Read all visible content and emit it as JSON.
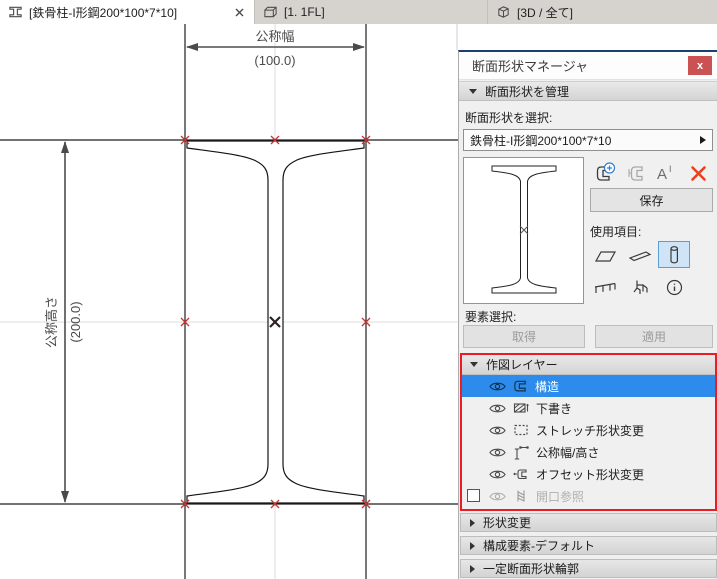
{
  "tabs": [
    {
      "icon": "i-beam-profile-icon",
      "label": "[鉄骨柱-I形鋼200*100*7*10]",
      "active": true
    },
    {
      "icon": "floor-plan-icon",
      "label": "[1. 1FL]",
      "active": false
    },
    {
      "icon": "3d-view-icon",
      "label": "[3D / 全て]",
      "active": false
    }
  ],
  "canvas": {
    "width_dim": {
      "label": "公称幅",
      "value": "(100.0)"
    },
    "height_dim": {
      "label": "公称高さ",
      "value": "(200.0)"
    }
  },
  "panel": {
    "title": "断面形状マネージャ",
    "close_label": "x",
    "manage_section": "断面形状を管理",
    "select_label": "断面形状を選択:",
    "profile_name": "鉄骨柱-I形鋼200*100*7*10",
    "save": "保存",
    "use_with_label": "使用項目:",
    "element_select_label": "要素選択:",
    "get": "取得",
    "apply": "適用",
    "layers_section": "作図レイヤー",
    "layers": [
      {
        "label": "構造",
        "icon": "profile-layer-icon",
        "selected": true,
        "visible": true
      },
      {
        "label": "下書き",
        "icon": "draft-layer-icon",
        "visible": true
      },
      {
        "label": "ストレッチ形状変更",
        "icon": "stretch-layer-icon",
        "visible": true
      },
      {
        "label": "公称幅/高さ",
        "icon": "nominal-size-layer-icon",
        "visible": true
      },
      {
        "label": "オフセット形状変更",
        "icon": "offset-layer-icon",
        "visible": true
      },
      {
        "label": "開口参照",
        "icon": "opening-layer-icon",
        "disabled": true,
        "checked": false
      }
    ],
    "collapsed_sections": [
      "形状変更",
      "構成要素-デフォルト",
      "一定断面形状輪郭"
    ],
    "action_icons": [
      "new-profile-icon",
      "duplicate-profile-icon",
      "rename-icon",
      "delete-icon"
    ],
    "use_with_icons": [
      "wall-icon",
      "beam-icon",
      "column-icon",
      "railing-icon",
      "object-icon",
      "info-icon"
    ]
  },
  "colors": {
    "selection_blue": "#2d8ceb",
    "highlight_red": "#ec1c24",
    "marker_red": "#c63434",
    "delete_red": "#e8431f",
    "close_button_red": "#ca5252",
    "panel_top_navy": "#1c3f6e",
    "use_with_selected_bg": "#cfe4f7"
  }
}
